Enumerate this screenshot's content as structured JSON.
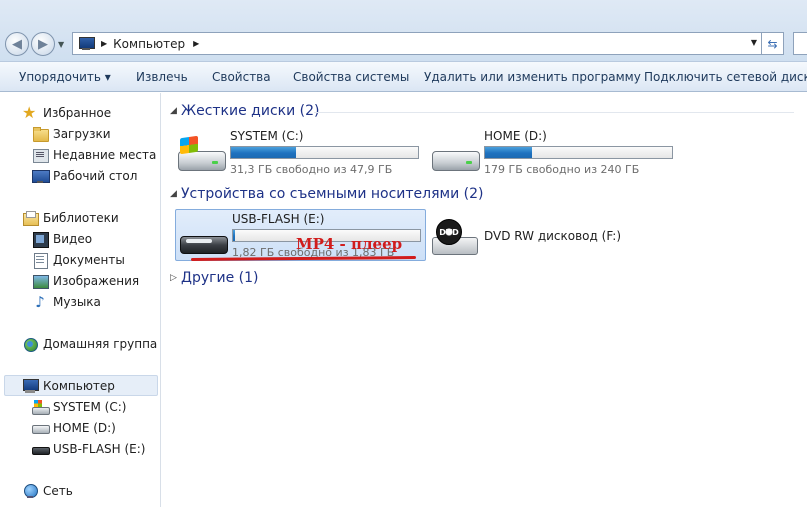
{
  "address_bar": {
    "crumb": "Компьютер",
    "back_icon": "back-arrow-icon",
    "forward_icon": "forward-arrow-icon"
  },
  "toolbar": {
    "organize": "Упорядочить ▾",
    "eject": "Извлечь",
    "properties": "Свойства",
    "system_properties": "Свойства системы",
    "uninstall": "Удалить или изменить программу",
    "map_drive": "Подключить сетевой диск"
  },
  "sidebar": {
    "favorites": "Избранное",
    "downloads": "Загрузки",
    "recent": "Недавние места",
    "desktop": "Рабочий стол",
    "libraries": "Библиотеки",
    "video": "Видео",
    "documents": "Документы",
    "images": "Изображения",
    "music": "Музыка",
    "homegroup": "Домашняя группа",
    "computer": "Компьютер",
    "drive_c": "SYSTEM (C:)",
    "drive_d": "HOME (D:)",
    "drive_e": "USB-FLASH (E:)",
    "network": "Сеть"
  },
  "groups": {
    "hard_disks": "Жесткие диски (2)",
    "removable": "Устройства со съемными носителями (2)",
    "other": "Другие (1)"
  },
  "drives": {
    "c": {
      "name": "SYSTEM (C:)",
      "free": "31,3 ГБ свободно из 47,9 ГБ",
      "used_fraction": 0.35
    },
    "d": {
      "name": "HOME (D:)",
      "free": "179 ГБ свободно из 240 ГБ",
      "used_fraction": 0.25
    },
    "e": {
      "name": "USB-FLASH (E:)",
      "free": "1,82 ГБ свободно из 1,83 ГБ",
      "used_fraction": 0.01
    },
    "f": {
      "name": "DVD RW дисковод (F:)"
    }
  },
  "annotation": "MP4 - плеер",
  "colors": {
    "accent": "#1e3287",
    "annotation": "#d11c1c",
    "bar_fill": "#1f72bf"
  }
}
